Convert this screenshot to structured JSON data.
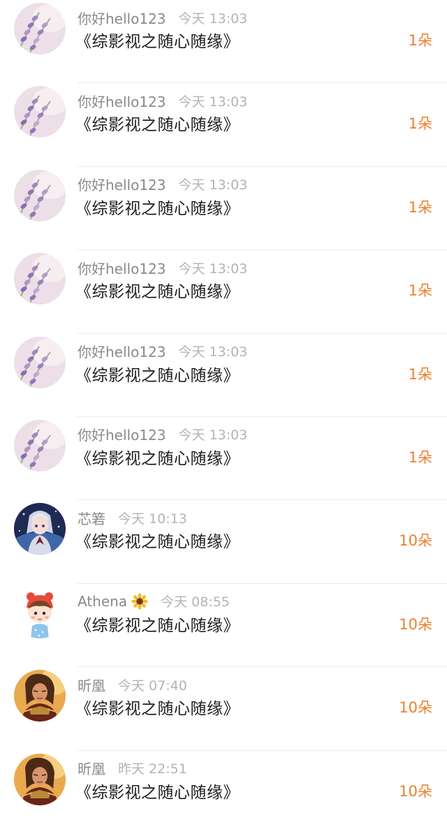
{
  "gift_list": [
    {
      "user": "你好hello123",
      "time": "今天 13:03",
      "book": "《综影视之随心随缘》",
      "amount": "1朵",
      "avatar": "lavender-flowers-avatar"
    },
    {
      "user": "你好hello123",
      "time": "今天 13:03",
      "book": "《综影视之随心随缘》",
      "amount": "1朵",
      "avatar": "lavender-flowers-avatar"
    },
    {
      "user": "你好hello123",
      "time": "今天 13:03",
      "book": "《综影视之随心随缘》",
      "amount": "1朵",
      "avatar": "lavender-flowers-avatar"
    },
    {
      "user": "你好hello123",
      "time": "今天 13:03",
      "book": "《综影视之随心随缘》",
      "amount": "1朵",
      "avatar": "lavender-flowers-avatar"
    },
    {
      "user": "你好hello123",
      "time": "今天 13:03",
      "book": "《综影视之随心随缘》",
      "amount": "1朵",
      "avatar": "lavender-flowers-avatar"
    },
    {
      "user": "你好hello123",
      "time": "今天 13:03",
      "book": "《综影视之随心随缘》",
      "amount": "1朵",
      "avatar": "lavender-flowers-avatar"
    },
    {
      "user": "芯箬",
      "time": "今天 10:13",
      "book": "《综影视之随心随缘》",
      "amount": "10朵",
      "avatar": "anime-girl-avatar"
    },
    {
      "user": "Athena",
      "time": "今天 08:55",
      "book": "《综影视之随心随缘》",
      "amount": "10朵",
      "avatar": "cartoon-girl-avatar",
      "name_emoji": "sunflower-icon"
    },
    {
      "user": "昕凰",
      "time": "今天 07:40",
      "book": "《综影视之随心随缘》",
      "amount": "10朵",
      "avatar": "warrior-avatar"
    },
    {
      "user": "昕凰",
      "time": "昨天 22:51",
      "book": "《综影视之随心随缘》",
      "amount": "10朵",
      "avatar": "warrior-avatar"
    }
  ],
  "colors": {
    "amount": "#ee7f2d",
    "username": "#8a8a8a",
    "timestamp": "#b3b3b3",
    "title": "#1e1e1e",
    "divider": "#ececec"
  }
}
